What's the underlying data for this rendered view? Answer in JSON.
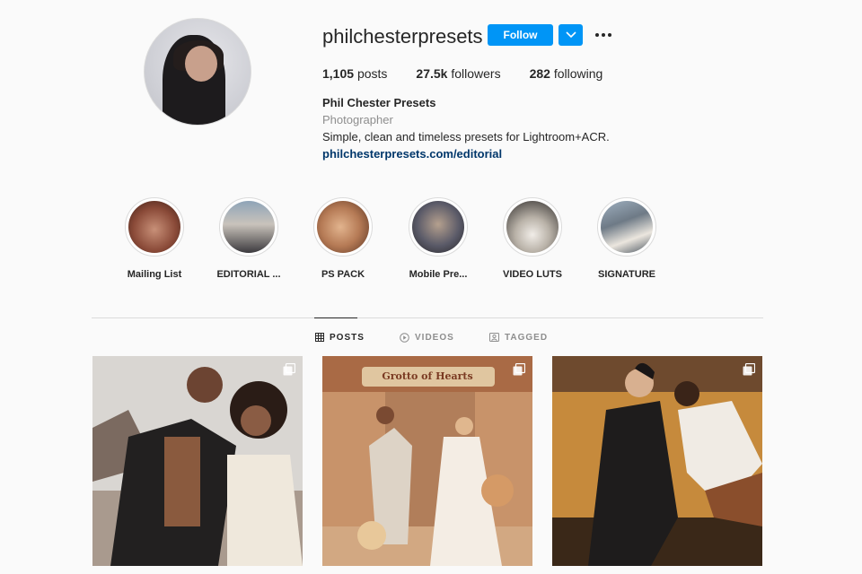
{
  "profile": {
    "username": "philchesterpresets",
    "follow_label": "Follow",
    "stats": {
      "posts_count": "1,105",
      "posts_label": "posts",
      "followers_count": "27.5k",
      "followers_label": "followers",
      "following_count": "282",
      "following_label": "following"
    },
    "full_name": "Phil Chester Presets",
    "category": "Photographer",
    "bio": "Simple, clean and timeless presets for Lightroom+ACR.",
    "link": "philchesterpresets.com/editorial"
  },
  "highlights": [
    {
      "label": "Mailing List"
    },
    {
      "label": "EDITORIAL ..."
    },
    {
      "label": "PS PACK"
    },
    {
      "label": "Mobile Pre..."
    },
    {
      "label": "VIDEO LUTS"
    },
    {
      "label": "SIGNATURE"
    }
  ],
  "tabs": [
    {
      "label": "POSTS",
      "active": true
    },
    {
      "label": "VIDEOS",
      "active": false
    },
    {
      "label": "TAGGED",
      "active": false
    }
  ],
  "posts": [
    {
      "icon": "carousel-icon"
    },
    {
      "icon": "carousel-icon",
      "sign_text": "Grotto of Hearts"
    },
    {
      "icon": "carousel-icon"
    }
  ],
  "colors": {
    "accent": "#0095f6",
    "link": "#00376b",
    "text": "#262626",
    "muted": "#8e8e8e",
    "background": "#fafafa"
  }
}
